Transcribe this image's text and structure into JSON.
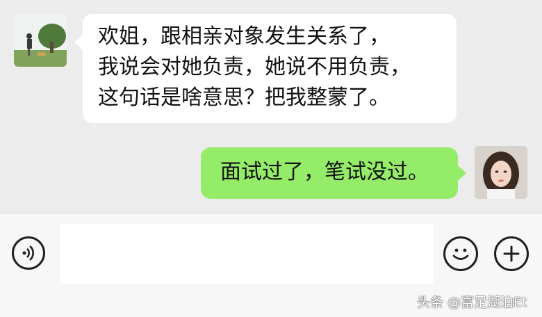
{
  "chat": {
    "messages": [
      {
        "side": "left",
        "lines": [
          "欢姐，跟相亲对象发生关系了，",
          "我说会对她负责，她说不用负责，",
          "这句话是啥意思？把我整蒙了。"
        ],
        "bubble_color": "#ffffff"
      },
      {
        "side": "right",
        "lines": [
          "面试过了，笔试没过。"
        ],
        "bubble_color": "#95ec69"
      }
    ]
  },
  "composer": {
    "input_value": "",
    "icons": {
      "voice": "voice-icon",
      "emoji": "emoji-icon",
      "plus": "plus-icon"
    }
  },
  "watermark": "头条 @富足湖泊Et",
  "colors": {
    "chat_background": "#ececec",
    "composer_background": "#f7f7f7",
    "sent_bubble": "#95ec69",
    "received_bubble": "#ffffff"
  }
}
